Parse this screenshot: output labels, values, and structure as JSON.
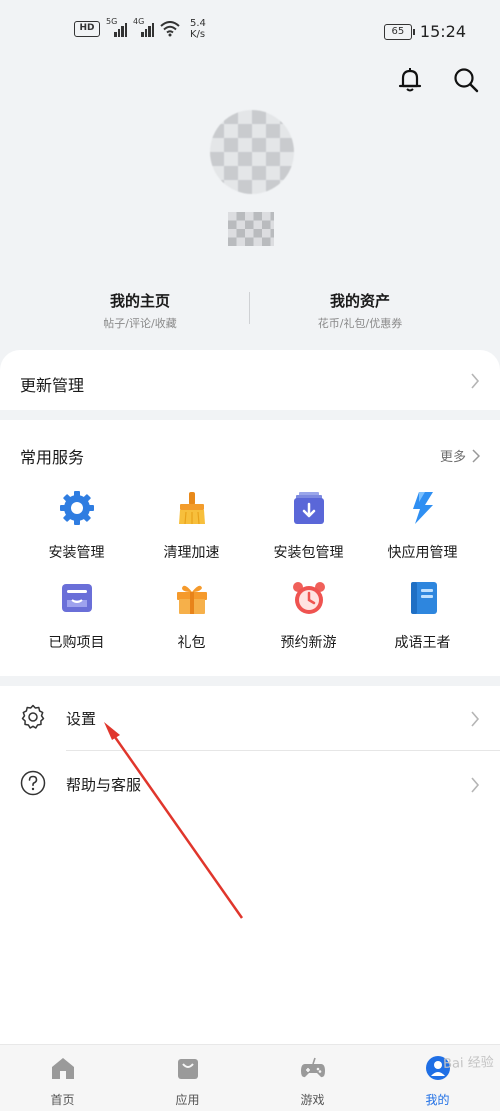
{
  "status_bar": {
    "hd_badge": "HD",
    "signal1": "5G",
    "signal2": "4G",
    "speed_value": "5.4",
    "speed_unit": "K/s",
    "battery": "65",
    "time": "15:24"
  },
  "header": {
    "notification_icon": "bell-icon",
    "search_icon": "search-icon"
  },
  "quick_links": [
    {
      "title": "我的主页",
      "subtitle": "帖子/评论/收藏"
    },
    {
      "title": "我的资产",
      "subtitle": "花币/礼包/优惠券"
    }
  ],
  "update_section": {
    "label": "更新管理"
  },
  "services": {
    "title": "常用服务",
    "more_label": "更多",
    "items": [
      {
        "label": "安装管理",
        "icon": "gear-blue-icon"
      },
      {
        "label": "清理加速",
        "icon": "broom-icon"
      },
      {
        "label": "安装包管理",
        "icon": "package-icon"
      },
      {
        "label": "快应用管理",
        "icon": "lightning-icon"
      },
      {
        "label": "已购项目",
        "icon": "purchased-icon"
      },
      {
        "label": "礼包",
        "icon": "gift-icon"
      },
      {
        "label": "预约新游",
        "icon": "alarm-clock-icon"
      },
      {
        "label": "成语王者",
        "icon": "book-icon"
      }
    ]
  },
  "settings_list": [
    {
      "label": "设置",
      "icon": "settings-gear-icon"
    },
    {
      "label": "帮助与客服",
      "icon": "help-icon"
    }
  ],
  "bottom_nav": [
    {
      "label": "首页",
      "icon": "home-icon"
    },
    {
      "label": "应用",
      "icon": "apps-bag-icon"
    },
    {
      "label": "游戏",
      "icon": "gamepad-icon"
    },
    {
      "label": "我的",
      "icon": "profile-icon",
      "active": true
    }
  ],
  "watermark": "Bai 经验",
  "colors": {
    "accent": "#1f6fe5",
    "annotation_arrow": "#e0362c"
  }
}
